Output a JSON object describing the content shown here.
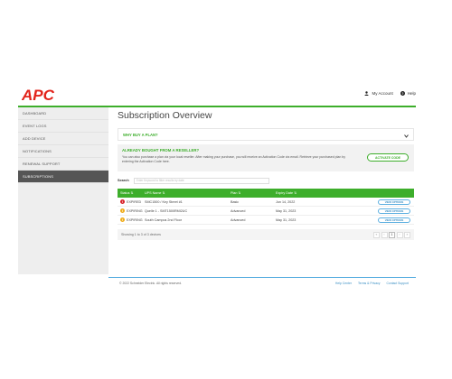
{
  "brand": {
    "logo_text": "APC",
    "accent_color": "#3dae2b",
    "logo_color": "#e2231a"
  },
  "header": {
    "account_label": "My Account",
    "account_icon": "user-icon",
    "help_label": "Help",
    "help_icon": "help-icon"
  },
  "sidebar": {
    "items": [
      {
        "label": "DASHBOARD",
        "active": false
      },
      {
        "label": "EVENT LOGS",
        "active": false
      },
      {
        "label": "ADD DEVICE",
        "active": false
      },
      {
        "label": "NOTIFICATIONS",
        "active": false
      },
      {
        "label": "RENEWAL SUPPORT",
        "active": false
      },
      {
        "label": "SUBSCRIPTIONS",
        "active": true
      }
    ]
  },
  "main": {
    "title": "Subscription Overview",
    "accordion_label": "WHY BUY A PLAN?",
    "reseller": {
      "title": "ALREADY BOUGHT FROM A RESELLER?",
      "text": "You can also purchase a plan via your local reseller. After making your purchase, you will receive an Activation Code via email. Retrieve your purchased plan by entering the Activation Code here.",
      "button_label": "ACTIVATE CODE"
    },
    "search": {
      "label": "Search",
      "placeholder": "Enter Keyword to filter results by date"
    },
    "table": {
      "headers": [
        "Status ⇅",
        "UPS Name ⇅",
        "Plan ⇅",
        "Expiry Date ⇅",
        ""
      ],
      "rows": [
        {
          "status": "EXPIRED",
          "status_icon": "error-icon",
          "status_color": "red",
          "name": "SMC1500 / Key Street #1",
          "plan": "Basic",
          "expiry": "Jun 14, 2022",
          "action": "VIEW OPTIONS"
        },
        {
          "status": "EXPIRING",
          "status_icon": "warning-icon",
          "status_color": "amber",
          "name": "Quelle 1 - SMT1500RMI2UC",
          "plan": "Advanced",
          "expiry": "May 31, 2023",
          "action": "VIEW OPTIONS"
        },
        {
          "status": "EXPIRING",
          "status_icon": "warning-icon",
          "status_color": "amber",
          "name": "South Campus 2nd Floor",
          "plan": "Advanced",
          "expiry": "May 31, 2023",
          "action": "VIEW OPTIONS"
        }
      ],
      "showing": "Showing 1 to 3 of 3 devices",
      "pager": [
        "«",
        "‹",
        "1",
        "›",
        "»"
      ],
      "current_page": "1"
    }
  },
  "footer": {
    "copyright": "© 2022 Schneider Electric. All rights reserved.",
    "links": [
      "Help Center",
      "Terms & Privacy",
      "Contact Support"
    ]
  }
}
